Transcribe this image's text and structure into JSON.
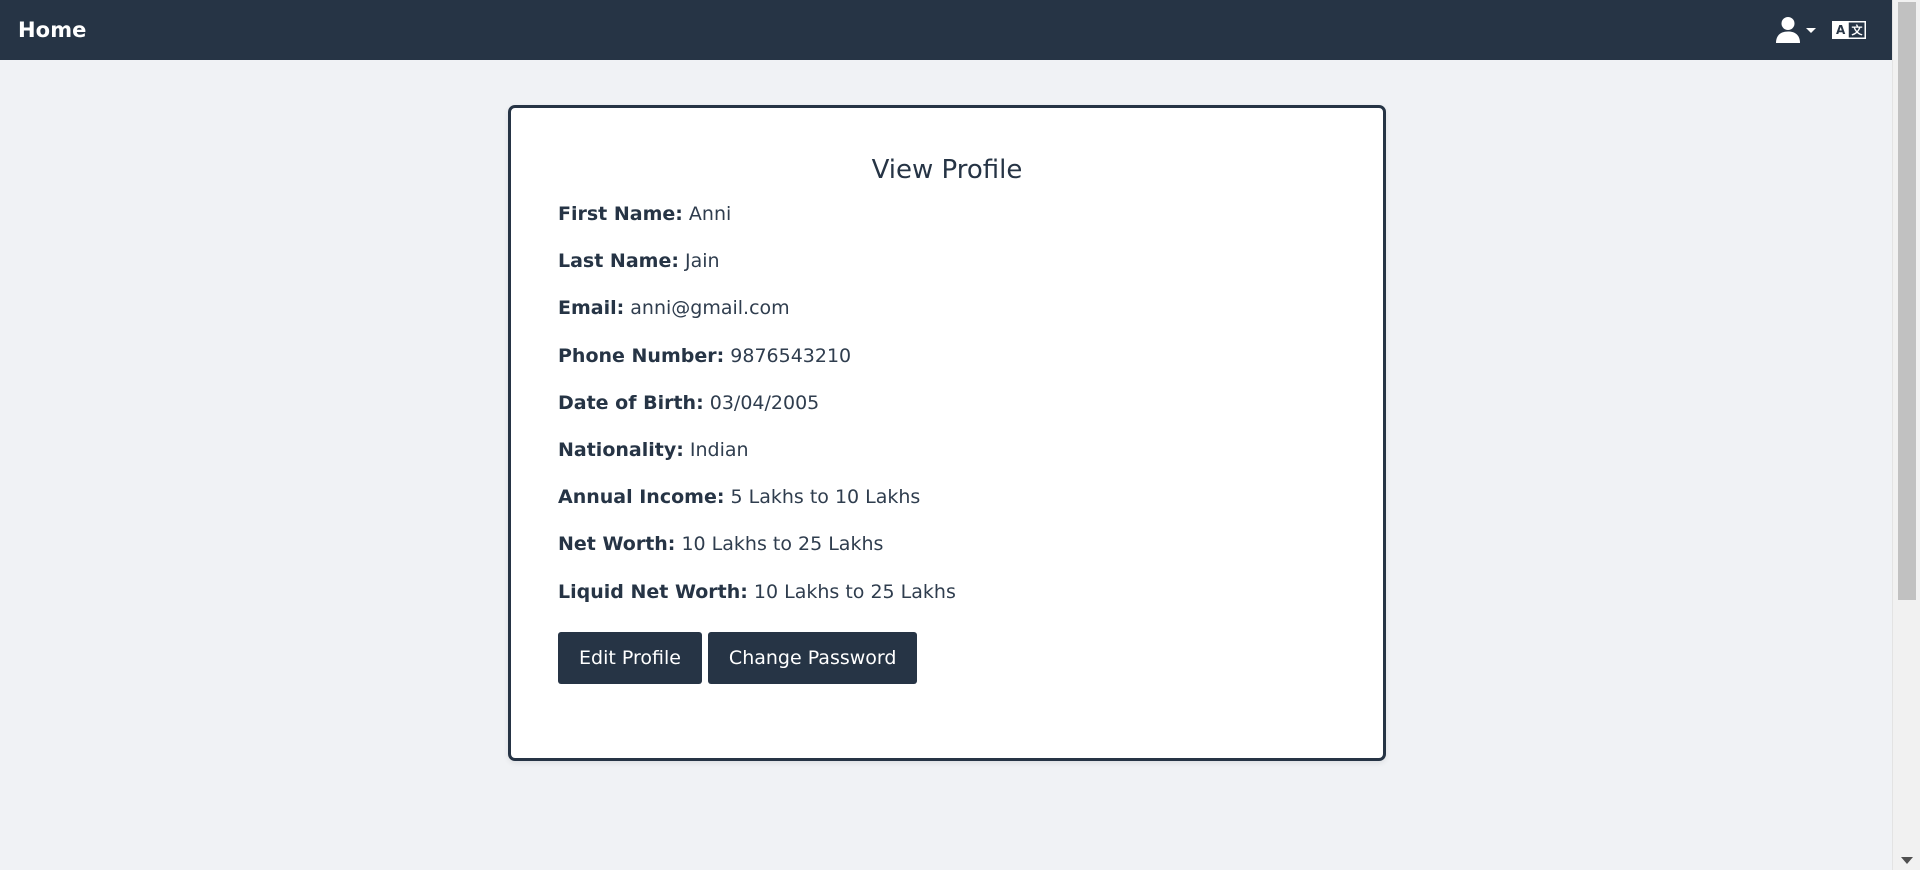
{
  "navbar": {
    "brand": "Home",
    "user_icon": "user-icon",
    "language_icon": "translate-icon"
  },
  "profile": {
    "title": "View Profile",
    "fields": [
      {
        "label": "First Name:",
        "value": "Anni"
      },
      {
        "label": "Last Name:",
        "value": "Jain"
      },
      {
        "label": "Email:",
        "value": "anni@gmail.com"
      },
      {
        "label": "Phone Number:",
        "value": "9876543210"
      },
      {
        "label": "Date of Birth:",
        "value": "03/04/2005"
      },
      {
        "label": "Nationality:",
        "value": "Indian"
      },
      {
        "label": "Annual Income:",
        "value": "5 Lakhs to 10 Lakhs"
      },
      {
        "label": "Net Worth:",
        "value": "10 Lakhs to 25 Lakhs"
      },
      {
        "label": "Liquid Net Worth:",
        "value": "10 Lakhs to 25 Lakhs"
      }
    ],
    "buttons": {
      "edit": "Edit Profile",
      "change_password": "Change Password"
    }
  },
  "colors": {
    "navbar_bg": "#263445",
    "page_bg": "#f0f2f5",
    "card_border": "#263445",
    "button_bg": "#263445",
    "button_text": "#ffffff"
  }
}
